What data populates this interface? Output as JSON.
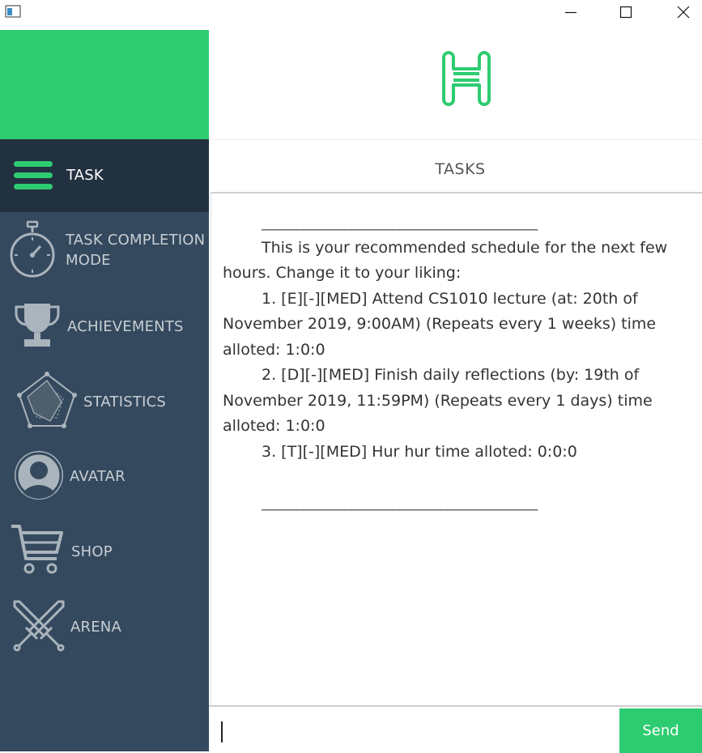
{
  "window": {
    "icon": "app-window-icon",
    "controls": [
      "minimize-icon",
      "maximize-icon",
      "close-icon"
    ]
  },
  "colors": {
    "accent": "#2ecc71",
    "sidebar": "#34495e",
    "sidebar_active": "#22313f"
  },
  "sidebar": {
    "items": [
      {
        "label": "TASK",
        "icon": "hamburger-menu-icon",
        "active": true
      },
      {
        "label": "TASK COMPLETION\nMODE",
        "icon": "stopwatch-icon"
      },
      {
        "label": "ACHIEVEMENTS",
        "icon": "trophy-icon"
      },
      {
        "label": "STATISTICS",
        "icon": "radar-chart-icon"
      },
      {
        "label": "AVATAR",
        "icon": "user-avatar-icon"
      },
      {
        "label": "SHOP",
        "icon": "shopping-cart-icon"
      },
      {
        "label": "ARENA",
        "icon": "crossed-swords-icon"
      }
    ]
  },
  "header": {
    "logo": "h-logo-icon",
    "title": "TASKS"
  },
  "message": {
    "rule_top": "________________________________________",
    "intro": "This is your recommended schedule for the next few hours. Change it to your liking:",
    "items": [
      "1. [E][-][MED] Attend CS1010 lecture (at: 20th of November 2019, 9:00AM) (Repeats every 1 weeks) time alloted: 1:0:0",
      "2. [D][-][MED] Finish daily reflections (by: 19th of November 2019, 11:59PM) (Repeats every 1 days) time alloted: 1:0:0",
      "3. [T][-][MED] Hur hur time alloted: 0:0:0"
    ],
    "rule_bottom": "________________________________________"
  },
  "input": {
    "value": "",
    "send_label": "Send"
  }
}
